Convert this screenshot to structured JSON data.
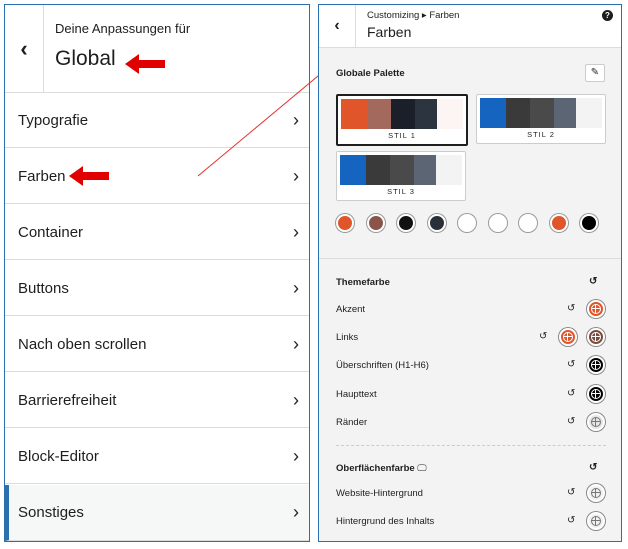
{
  "left": {
    "header": {
      "back": "‹",
      "subtitle": "Deine Anpassungen für",
      "title": "Global"
    },
    "items": [
      {
        "label": "Typografie"
      },
      {
        "label": "Farben"
      },
      {
        "label": "Container"
      },
      {
        "label": "Buttons"
      },
      {
        "label": "Nach oben scrollen"
      },
      {
        "label": "Barrierefreiheit"
      },
      {
        "label": "Block-Editor"
      },
      {
        "label": "Sonstiges"
      }
    ],
    "chevron": "›"
  },
  "right": {
    "header": {
      "back": "‹",
      "breadcrumb": "Customizing ▸ Farben",
      "title": "Farben",
      "help": "?"
    },
    "palette": {
      "title": "Globale Palette",
      "styles": [
        {
          "label": "STIL 1",
          "colors": [
            "#e0552a",
            "#a2695c",
            "#1a1f2a",
            "#2c3440",
            "#fdf5f3"
          ]
        },
        {
          "label": "STIL 2",
          "colors": [
            "#1565c0",
            "#3a3a3a",
            "#4a4a4a",
            "#5c6574",
            "#f3f3f3"
          ]
        },
        {
          "label": "STIL 3",
          "colors": [
            "#1565c0",
            "#3a3a3a",
            "#4a4a4a",
            "#5c6574",
            "#f3f3f3"
          ]
        }
      ],
      "dots": [
        "#e0552a",
        "#8a5448",
        "#111111",
        "#2a3038",
        "#ffffff",
        "#ffffff",
        "#ffffff",
        "#e0552a",
        "#000000"
      ]
    },
    "theme": {
      "title": "Themefarbe",
      "rows": [
        {
          "label": "Akzent",
          "colors": [
            "#e0552a"
          ]
        },
        {
          "label": "Links",
          "colors": [
            "#e0552a",
            "#7a4a40"
          ]
        },
        {
          "label": "Überschriften (H1-H6)",
          "colors": [
            "#000000"
          ]
        },
        {
          "label": "Haupttext",
          "colors": [
            "#000000"
          ]
        },
        {
          "label": "Ränder",
          "colors": [
            "#e6e6e6"
          ]
        }
      ]
    },
    "surface": {
      "title": "Oberflächenfarbe",
      "rows": [
        {
          "label": "Website-Hintergrund",
          "colors": [
            "#f0f0f0"
          ]
        },
        {
          "label": "Hintergrund des Inhalts",
          "colors": [
            "#f0f0f0"
          ]
        }
      ]
    },
    "reset_glyph": "↺",
    "monitor_glyph": "🖵",
    "edit_glyph": "✎"
  }
}
